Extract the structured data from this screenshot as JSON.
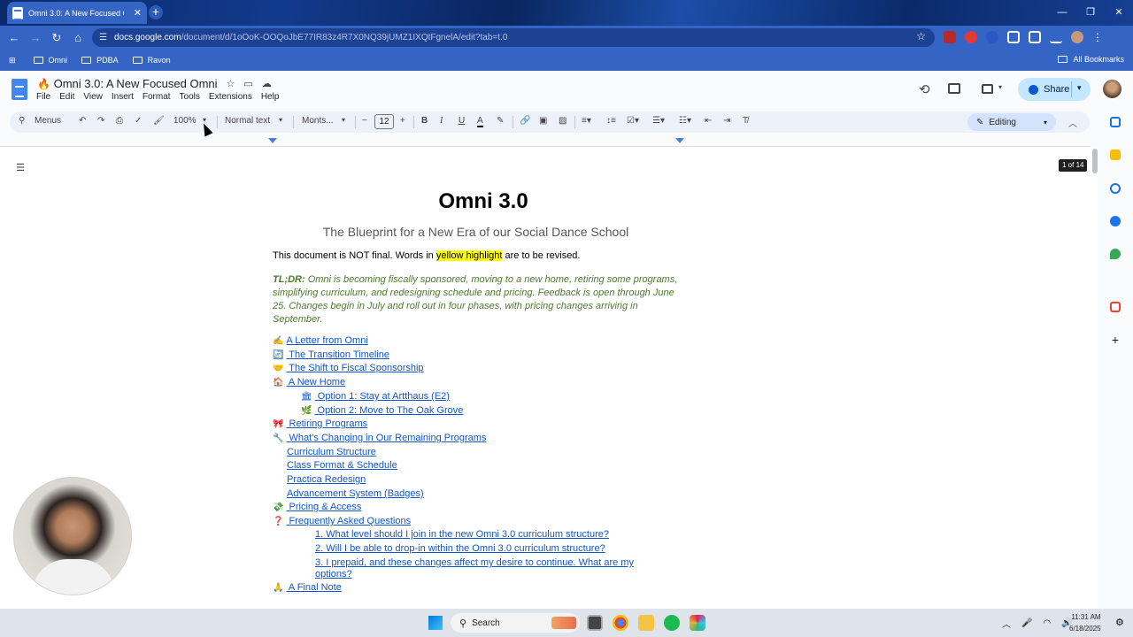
{
  "browser": {
    "tab_title": "Omni 3.0: A New Focused Omni",
    "tab_close": "✕",
    "new_tab": "+",
    "window_controls": [
      "—",
      "❐",
      "✕"
    ],
    "url_site": "docs.google.com",
    "url_path": "/document/d/1oOoK-OOQoJbE77IR83z4R7X0NQ39jUMZ1IXQtFgnelA/edit?tab=t.0",
    "bookmarks": [
      "Omni",
      "PDBA",
      "Ravon"
    ],
    "all_bookmarks": "All Bookmarks",
    "ext_badge": "15"
  },
  "docs": {
    "title": "Omni 3.0: A New Focused Omni",
    "title_emoji": "🔥",
    "menu": [
      "File",
      "Edit",
      "View",
      "Insert",
      "Format",
      "Tools",
      "Extensions",
      "Help"
    ],
    "share_label": "Share",
    "toolbar": {
      "menus_label": "Menus",
      "zoom": "100%",
      "style": "Normal text",
      "font": "Monts...",
      "font_size": "12",
      "editing": "Editing"
    },
    "page_count": "1 of 14"
  },
  "document": {
    "title": "Omni 3.0",
    "subtitle": "The Blueprint for a New Era of our Social Dance School",
    "notice_pre": "This document is NOT final. Words in ",
    "notice_hl": "yellow highlight",
    "notice_post": " are to be revised.",
    "tldr_label": "TL;DR:",
    "tldr_text": " Omni is becoming fiscally sponsored, moving to a new home, retiring some programs, simplifying curriculum, and redesigning schedule and pricing. Feedback is open through June 25. Changes begin in July and roll out in four phases, with pricing changes arriving in September.",
    "toc": [
      {
        "emoji": "✍️",
        "text": "A Letter from Omni"
      },
      {
        "emoji": "🔄",
        "text": " The Transition Timeline"
      },
      {
        "emoji": "🤝",
        "text": " The Shift to Fiscal Sponsorship"
      },
      {
        "emoji": "🏠",
        "text": " A New Home"
      },
      {
        "emoji": "🏛",
        "text": " Option 1: Stay at Artthaus (E2)"
      },
      {
        "emoji": "🌿",
        "text": " Option 2: Move to The Oak Grove"
      },
      {
        "emoji": "🎀",
        "text": " Retiring Programs"
      },
      {
        "emoji": "🔧",
        "text": " What’s Changing in Our Remaining Programs"
      },
      {
        "emoji": "",
        "text": "Curriculum Structure"
      },
      {
        "emoji": "",
        "text": "Class Format & Schedule"
      },
      {
        "emoji": "",
        "text": "Practica Redesign"
      },
      {
        "emoji": "",
        "text": "Advancement System (Badges)"
      },
      {
        "emoji": "💸",
        "text": " Pricing & Access"
      },
      {
        "emoji": "❓",
        "text": " Frequently Asked Questions"
      },
      {
        "emoji": "",
        "text": "1. What level should I join in the new Omni 3.0 curriculum structure?"
      },
      {
        "emoji": "",
        "text": "2. Will I be able to drop-in within the Omni 3.0 curriculum structure?"
      },
      {
        "emoji": "",
        "text": "3. I prepaid, and these changes affect my desire to continue. What are my"
      },
      {
        "emoji": "",
        "text": "options?"
      },
      {
        "emoji": "🙏",
        "text": " A Final Note"
      }
    ]
  },
  "taskbar": {
    "search_label": "Search",
    "time": "11:31 AM",
    "date": "6/18/2025"
  },
  "icons": [
    "docs-logo-icon",
    "star-icon",
    "folder-icon",
    "cloud-icon",
    "history-icon",
    "comment-icon",
    "meet-icon",
    "globe-icon",
    "outline-icon",
    "windows-start-icon",
    "search-icon"
  ]
}
